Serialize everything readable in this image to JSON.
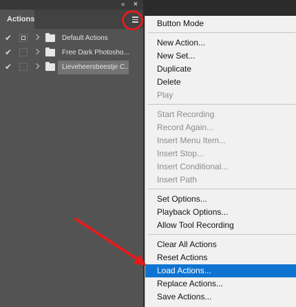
{
  "panel": {
    "tab_label": "Actions",
    "collapse_glyph": "«",
    "close_glyph": "×",
    "rows": [
      {
        "name": "Default Actions",
        "checked": true,
        "dialog": true,
        "selected": false
      },
      {
        "name": "Free Dark Photosho...",
        "checked": true,
        "dialog": false,
        "selected": false
      },
      {
        "name": "Lieveheersbeestje C...",
        "checked": true,
        "dialog": false,
        "selected": true
      }
    ]
  },
  "menu": {
    "items": [
      {
        "label": "Button Mode",
        "state": "enabled"
      },
      {
        "label": "New Action...",
        "state": "enabled"
      },
      {
        "label": "New Set...",
        "state": "enabled"
      },
      {
        "label": "Duplicate",
        "state": "enabled"
      },
      {
        "label": "Delete",
        "state": "enabled"
      },
      {
        "label": "Play",
        "state": "disabled"
      },
      {
        "label": "Start Recording",
        "state": "disabled"
      },
      {
        "label": "Record Again...",
        "state": "disabled"
      },
      {
        "label": "Insert Menu Item...",
        "state": "disabled"
      },
      {
        "label": "Insert Stop...",
        "state": "disabled"
      },
      {
        "label": "Insert Conditional...",
        "state": "disabled"
      },
      {
        "label": "Insert Path",
        "state": "disabled"
      },
      {
        "label": "Set Options...",
        "state": "enabled"
      },
      {
        "label": "Playback Options...",
        "state": "enabled"
      },
      {
        "label": "Allow Tool Recording",
        "state": "enabled"
      },
      {
        "label": "Clear All Actions",
        "state": "enabled"
      },
      {
        "label": "Reset Actions",
        "state": "enabled"
      },
      {
        "label": "Load Actions...",
        "state": "highlighted"
      },
      {
        "label": "Replace Actions...",
        "state": "enabled"
      },
      {
        "label": "Save Actions...",
        "state": "enabled"
      }
    ]
  },
  "colors": {
    "panel_bg": "#535353",
    "menu_bg": "#f1f1f1",
    "menu_highlight": "#0f74d1",
    "annotation_red": "#e51b1b"
  },
  "icons": [
    "check-icon",
    "dialog-toggle-icon",
    "chevron-right-icon",
    "folder-icon",
    "panel-menu-icon",
    "collapse-icon",
    "close-icon"
  ]
}
